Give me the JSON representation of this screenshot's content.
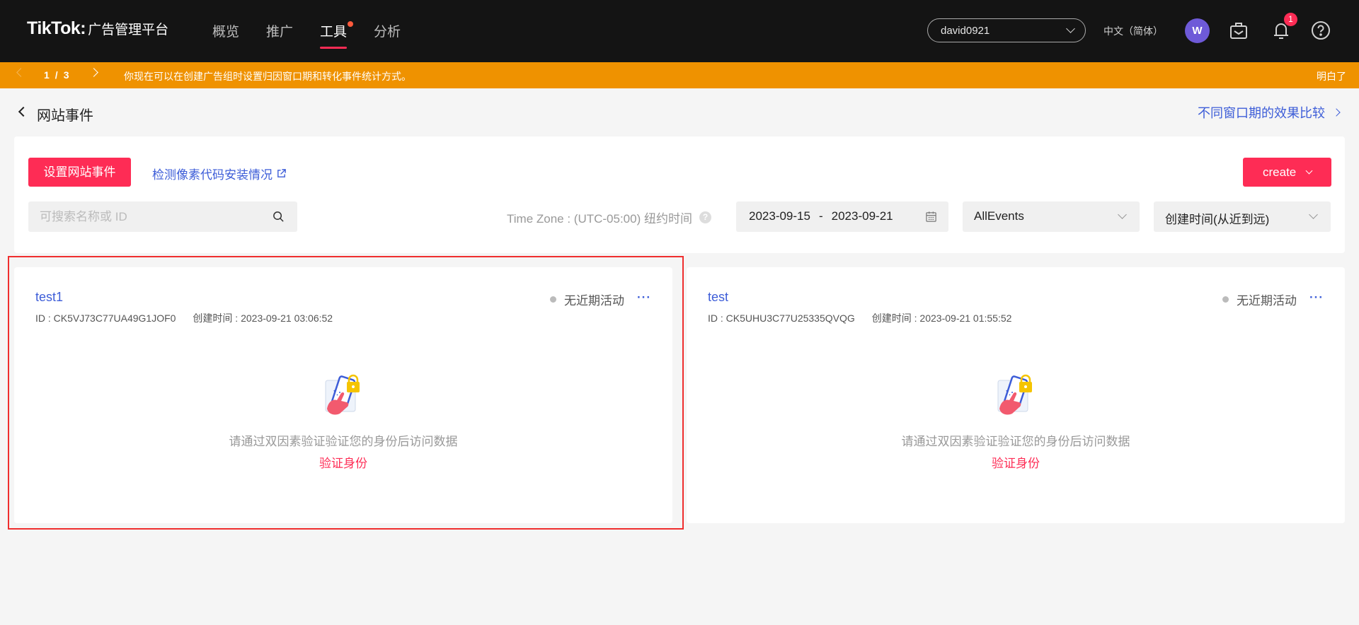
{
  "header": {
    "brand": "TikTok:",
    "brand_sub": "广告管理平台",
    "nav": [
      {
        "label": "概览"
      },
      {
        "label": "推广"
      },
      {
        "label": "工具"
      },
      {
        "label": "分析"
      }
    ],
    "account": "david0921",
    "language": "中文（简体）",
    "avatar_initial": "W",
    "notification_count": "1",
    "icons": [
      "briefcase-icon",
      "bell-icon",
      "help-icon"
    ]
  },
  "banner": {
    "current": "1",
    "separator": "/",
    "total": "3",
    "message": "你现在可以在创建广告组时设置归因窗口期和转化事件统计方式。",
    "dismiss": "明白了"
  },
  "page": {
    "title": "网站事件",
    "compare_link": "不同窗口期的效果比较"
  },
  "toolbar": {
    "setup_button": "设置网站事件",
    "check_link": "检测像素代码安装情况",
    "create_button": "create",
    "search_placeholder": "可搜索名称或 ID",
    "timezone": "Time Zone : (UTC-05:00) 纽约时间",
    "date_start": "2023-09-15",
    "date_sep": "-",
    "date_end": "2023-09-21",
    "event_filter": "AllEvents",
    "sort": "创建时间(从近到远)"
  },
  "events": [
    {
      "name": "test1",
      "id": "ID : CK5VJ73C77UA49G1JOF0",
      "created": "创建时间 : 2023-09-21 03:06:52",
      "status": "无近期活动",
      "more": "···",
      "message": "请通过双因素验证验证您的身份后访问数据",
      "verify": "验证身份"
    },
    {
      "name": "test",
      "id": "ID : CK5UHU3C77U25335QVQG",
      "created": "创建时间 : 2023-09-21 01:55:52",
      "status": "无近期活动",
      "more": "···",
      "message": "请通过双因素验证验证您的身份后访问数据",
      "verify": "验证身份"
    }
  ],
  "colors": {
    "accent": "#fe2c55",
    "link": "#3d5dd8",
    "banner": "#ef9200",
    "nav_bg": "#141414",
    "highlight": "#ef2e2e"
  }
}
